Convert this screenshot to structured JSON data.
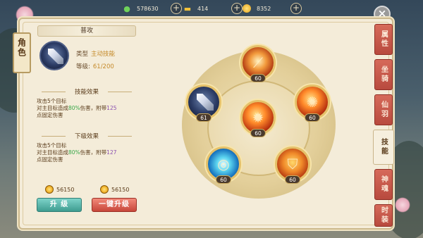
{
  "currencies": [
    {
      "icon": "leaf-icon",
      "value": "578630"
    },
    {
      "icon": "gold-ingot-icon",
      "value": "414"
    },
    {
      "icon": "coin-icon",
      "value": "8352"
    }
  ],
  "role_tab": "角色",
  "skill": {
    "name": "普攻",
    "type_label": "类型",
    "type_value": "主动技能",
    "level_label": "等级:",
    "level_value": "61/200"
  },
  "effect": {
    "title": "技能效果",
    "line1": "攻击5个目标",
    "line2_pre": "对主目标造成",
    "line2_pct": "80%",
    "line2_mid": "伤害，附带",
    "line2_val": "125",
    "line3": "点固定伤害"
  },
  "next_effect": {
    "title": "下级效果",
    "line1": "攻击5个目标",
    "line2_pre": "对主目标造成",
    "line2_pct": "80%",
    "line2_mid": "伤害，附带",
    "line2_val": "127",
    "line3": "点固定伤害"
  },
  "costs": {
    "upgrade": "56150",
    "one_key": "56150"
  },
  "buttons": {
    "upgrade": "升 级",
    "one_key": "一键升级"
  },
  "wheel": {
    "top": "60",
    "left": "61",
    "right": "60",
    "center": "60",
    "bottom_left": "60",
    "bottom_right": "60"
  },
  "tabs": [
    "属性",
    "坐骑",
    "仙羽",
    "技能",
    "神魂",
    "时装"
  ],
  "active_tab": "技能",
  "colors": {
    "accent_green": "#3aa84a",
    "accent_purple": "#8a4fb0",
    "gold": "#c58a2a"
  }
}
